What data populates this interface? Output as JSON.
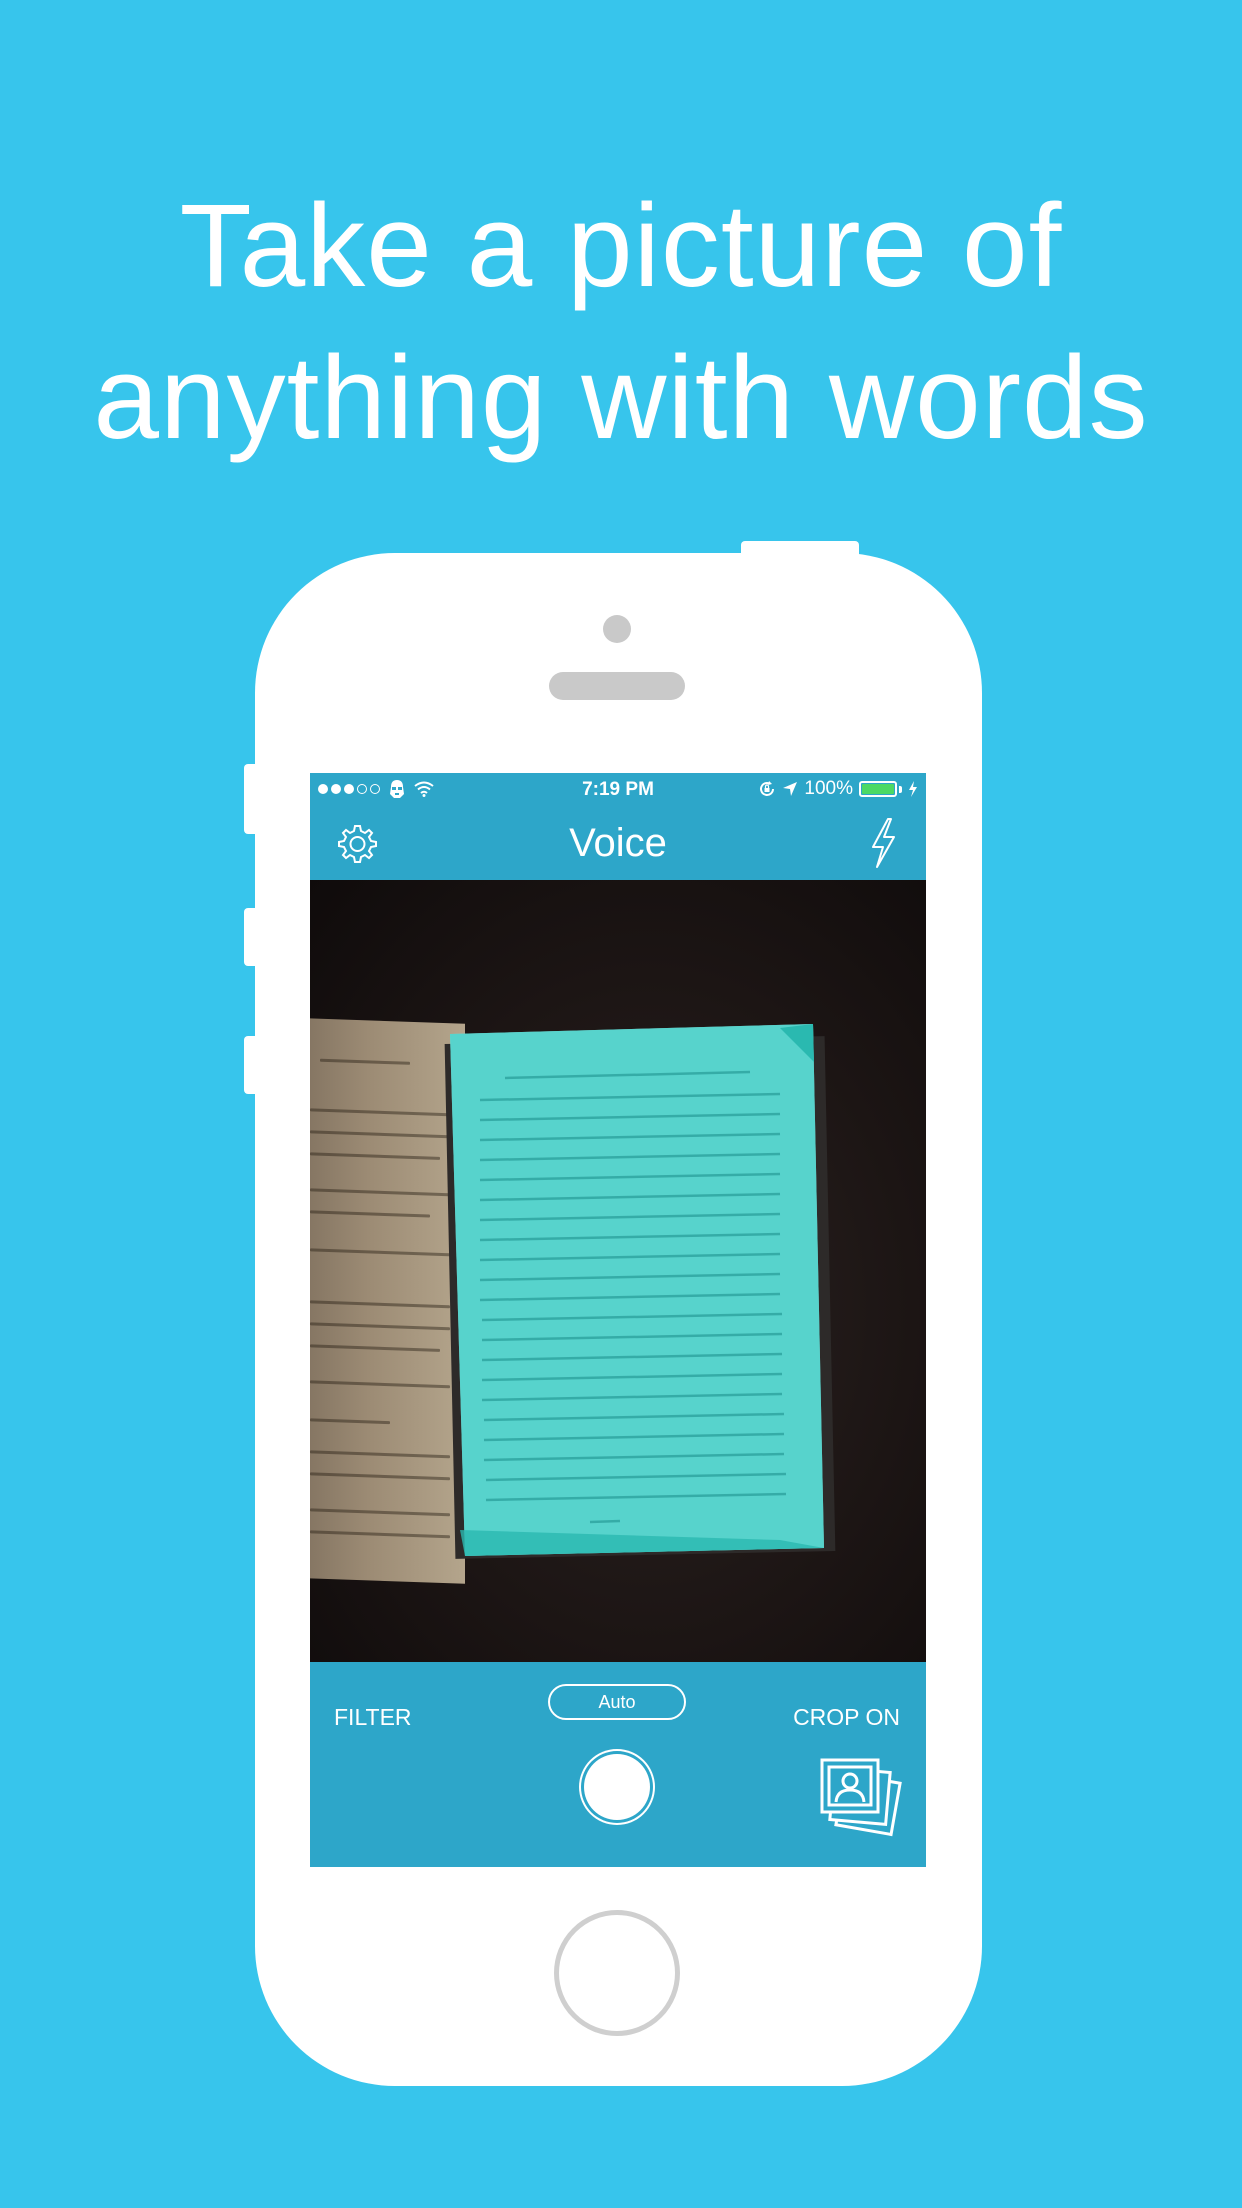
{
  "headline": {
    "line1": "Take a picture of",
    "line2": "anything with words"
  },
  "status_bar": {
    "signal_dots_filled": 3,
    "signal_dots_total": 5,
    "time": "7:19 PM",
    "battery_percent": "100%",
    "icons": [
      "stormtrooper-icon",
      "wifi-icon",
      "rotation-lock-icon",
      "location-icon",
      "battery-icon",
      "charging-icon"
    ]
  },
  "navbar": {
    "title": "Voice",
    "left_icon": "gear-icon",
    "right_icon": "flash-icon"
  },
  "toolbar": {
    "filter_label": "FILTER",
    "mode_label": "Auto",
    "crop_label": "CROP ON",
    "gallery_icon": "photo-gallery-icon"
  },
  "colors": {
    "background": "#37C5EC",
    "app_bar": "#2DA6C9",
    "document_overlay": "#3CD0C6",
    "battery_fill": "#4CD964"
  }
}
